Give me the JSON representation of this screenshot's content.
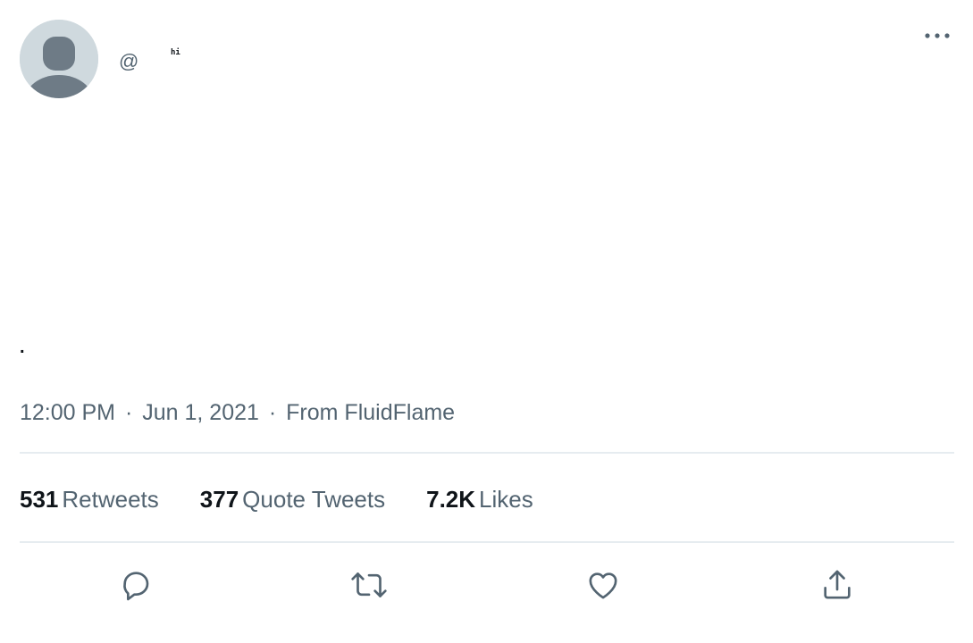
{
  "author": {
    "display_name": "hi",
    "handle": "@",
    "avatar_icon": "default-avatar-icon"
  },
  "tweet": {
    "text": "."
  },
  "meta": {
    "time": "12:00 PM",
    "separator": "·",
    "date": "Jun 1, 2021",
    "source": "From FluidFlame"
  },
  "stats": [
    {
      "value": "531",
      "label": "Retweets"
    },
    {
      "value": "377",
      "label": "Quote Tweets"
    },
    {
      "value": "7.2K",
      "label": "Likes"
    }
  ],
  "actions": [
    {
      "icon": "reply-icon"
    },
    {
      "icon": "retweet-icon"
    },
    {
      "icon": "like-icon"
    },
    {
      "icon": "share-icon"
    }
  ],
  "colors": {
    "secondary_text": "#536471",
    "primary_text": "#0f1419",
    "divider": "#e6ecf0",
    "avatar_bg": "#cfd9de",
    "avatar_silhouette": "#6e7b86"
  }
}
